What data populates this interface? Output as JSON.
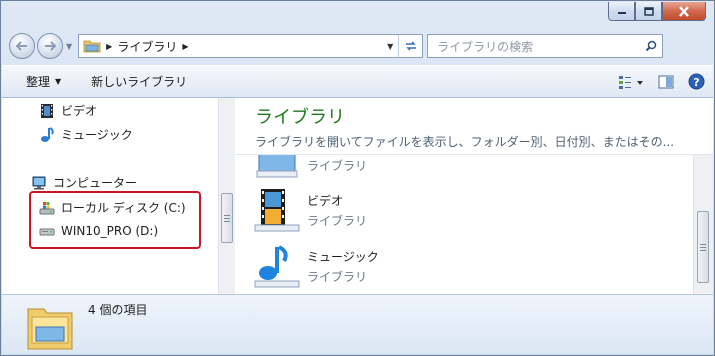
{
  "window": {
    "caption": [
      "minimize",
      "maximize",
      "close"
    ]
  },
  "address": {
    "crumb": "ライブラリ",
    "search_placeholder": "ライブラリの検索"
  },
  "toolbar": {
    "organize": "整理",
    "new_library": "新しいライブラリ"
  },
  "nav_pane": {
    "items": [
      {
        "label": "ビデオ",
        "icon": "video-icon"
      },
      {
        "label": "ミュージック",
        "icon": "music-icon"
      },
      {
        "label": "コンピューター",
        "icon": "computer-icon"
      },
      {
        "label": "ローカル ディスク (C:)",
        "icon": "local-disk-icon"
      },
      {
        "label": "WIN10_PRO (D:)",
        "icon": "drive-icon"
      }
    ],
    "highlight_color": "#c8182a"
  },
  "content": {
    "title": "ライブラリ",
    "description": "ライブラリを開いてファイルを表示し、フォルダー別、日付別、またはその...",
    "items": [
      {
        "name": "",
        "type": "ライブラリ"
      },
      {
        "name": "ビデオ",
        "type": "ライブラリ"
      },
      {
        "name": "ミュージック",
        "type": "ライブラリ"
      }
    ]
  },
  "status": {
    "count_text": "4 個の項目"
  },
  "colors": {
    "title_green": "#1e7a1e",
    "frame": "#c9d9ec"
  }
}
